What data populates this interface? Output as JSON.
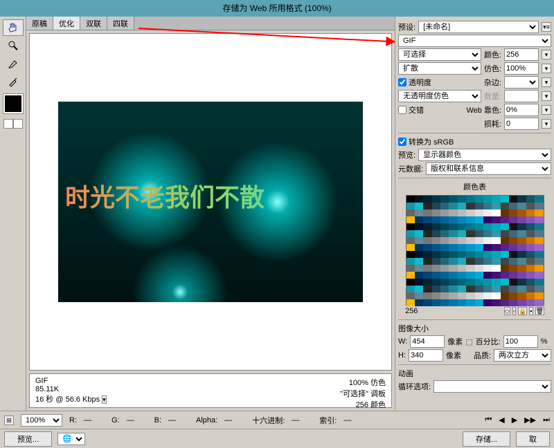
{
  "window": {
    "title": "存储为 Web 所用格式 (100%)"
  },
  "tools": [
    "hand",
    "zoom",
    "slice",
    "eyedrop"
  ],
  "tabs": [
    {
      "label": "原稿",
      "active": false
    },
    {
      "label": "优化",
      "active": true
    },
    {
      "label": "双联",
      "active": false
    },
    {
      "label": "四联",
      "active": false
    }
  ],
  "canvas_text": "时光不老我们不散",
  "status": {
    "format": "GIF",
    "size": "85.11K",
    "time": "16 秒 @ 56.6 Kbps",
    "opt_pct": "100% 仿色",
    "opt_mode": "\"可选择\" 调板",
    "opt_colors": "256 颜色"
  },
  "right": {
    "preset_label": "预设:",
    "preset_value": "[未命名]",
    "format": "GIF",
    "reduction": "可选择",
    "colors_label": "颜色:",
    "colors_value": "256",
    "dither": "扩散",
    "dither_label": "仿色:",
    "dither_value": "100%",
    "transparency": "透明度",
    "matte_label": "杂边:",
    "trans_dither": "无透明度仿色",
    "amount_label": "数量:",
    "interlace": "交错",
    "websnap_label": "Web 靠色:",
    "websnap_value": "0%",
    "lossy_label": "损耗:",
    "lossy_value": "0",
    "convert_srgb": "转换为 sRGB",
    "preview_label": "预览:",
    "preview_value": "显示器颜色",
    "metadata_label": "元数据:",
    "metadata_value": "版权和联系信息",
    "colortable_label": "颜色表",
    "colortable_count": "256",
    "image_size_label": "图像大小",
    "width_label": "W:",
    "width_value": "454",
    "height_label": "H:",
    "height_value": "340",
    "pixels": "像素",
    "percent_label": "百分比:",
    "percent_value": "100",
    "percent_unit": "%",
    "quality_label": "品质:",
    "quality_value": "两次立方",
    "anim_label": "动画",
    "loop_label": "循环选项:"
  },
  "bottom": {
    "zoom": "100%",
    "r_label": "R:",
    "g_label": "G:",
    "b_label": "B:",
    "alpha_label": "Alpha:",
    "hex_label": "十六进制:",
    "index_label": "索引:",
    "preview_btn": "预览...",
    "save_btn": "存储...",
    "cancel_btn": "取"
  }
}
